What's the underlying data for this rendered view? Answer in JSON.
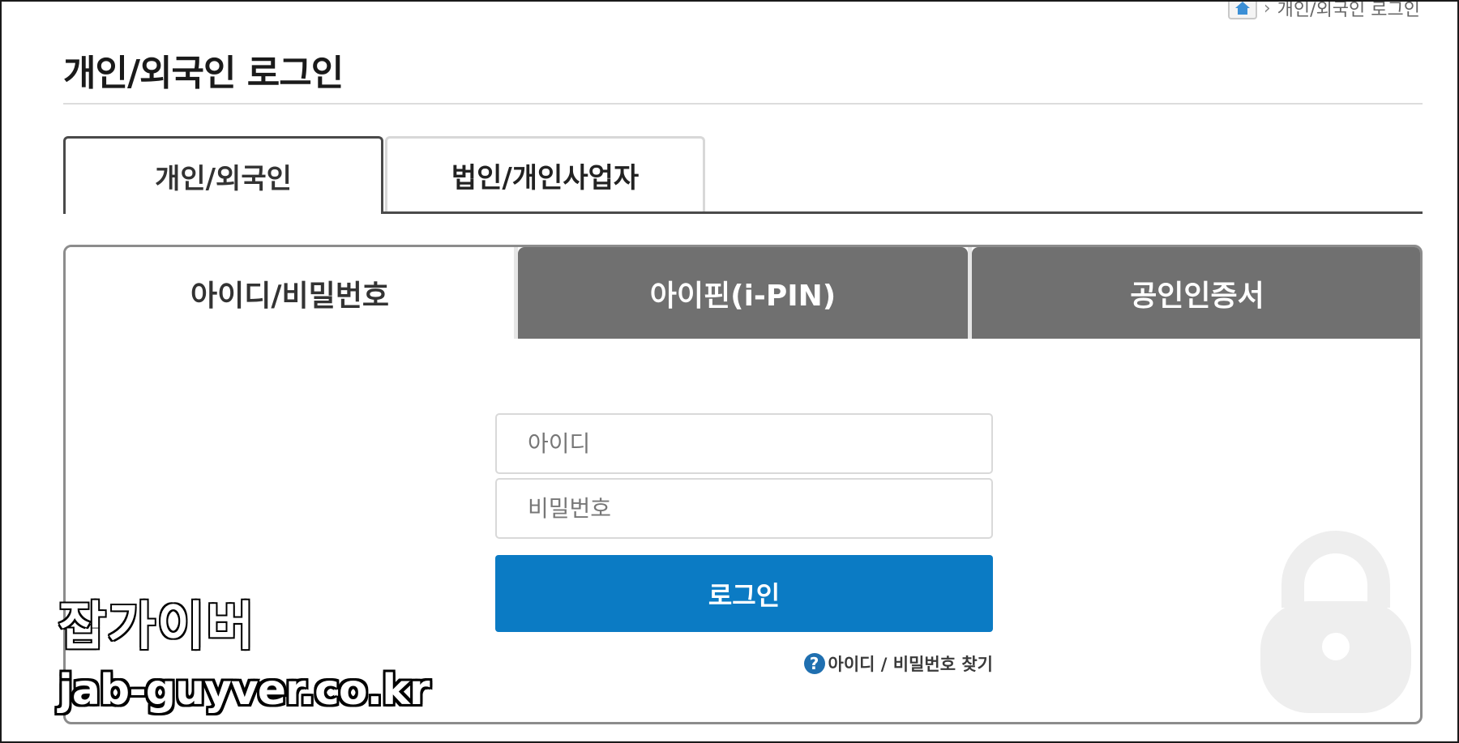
{
  "breadcrumb": {
    "icon": "home-icon",
    "current": "개인/외국인 로그인"
  },
  "page": {
    "title": "개인/외국인 로그인"
  },
  "user_tabs": [
    {
      "label": "개인/외국인",
      "active": true
    },
    {
      "label": "법인/개인사업자",
      "active": false
    }
  ],
  "login_methods": [
    {
      "label": "아이디/비밀번호",
      "active": true
    },
    {
      "label": "아이핀(i-PIN)",
      "active": false
    },
    {
      "label": "공인인증서",
      "active": false
    }
  ],
  "form": {
    "id_placeholder": "아이디",
    "password_placeholder": "비밀번호",
    "login_button": "로그인",
    "find_link": "아이디 / 비밀번호 찾기",
    "help_icon_glyph": "?"
  },
  "decor": {
    "lock_icon": "lock-icon",
    "lock_color": "#eeeeee"
  },
  "watermark": {
    "name": "잡가이버",
    "url": "jab-guyver.co.kr"
  },
  "colors": {
    "accent": "#0b7bc4",
    "tab_dark": "#707070",
    "border": "#8c8c8c"
  }
}
